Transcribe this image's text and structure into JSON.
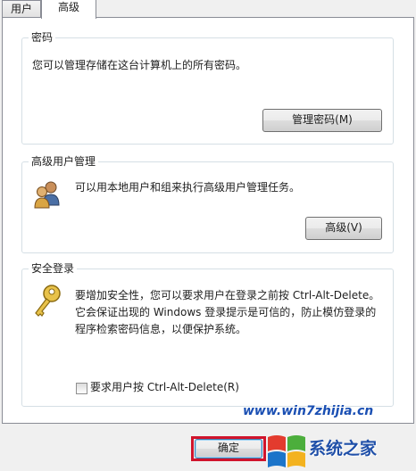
{
  "tabs": [
    {
      "label": "用户",
      "active": false
    },
    {
      "label": "高级",
      "active": true
    }
  ],
  "passwords": {
    "title": "密码",
    "description": "您可以管理存储在这台计算机上的所有密码。",
    "button": "管理密码(M)"
  },
  "advanced_users": {
    "title": "高级用户管理",
    "description": "可以用本地用户和组来执行高级用户管理任务。",
    "button": "高级(V)",
    "icon": "users-icon"
  },
  "secure_logon": {
    "title": "安全登录",
    "description_lines": [
      "要增加安全性，您可以要求用户在登录之前按 Ctrl-Alt-Delete。",
      "它会保证出现的 Windows 登录提示是可信的，防止模仿登录的",
      "程序检索密码信息，以便保护系统。"
    ],
    "checkbox_label": "要求用户按 Ctrl-Alt-Delete(R)",
    "checkbox_checked": false,
    "icon": "key-icon"
  },
  "footer": {
    "ok_button": "确定",
    "highlight_color": "#d0142c"
  },
  "watermark": {
    "url": "www.win7zhijia.cn",
    "logo_text": "系统之家"
  }
}
